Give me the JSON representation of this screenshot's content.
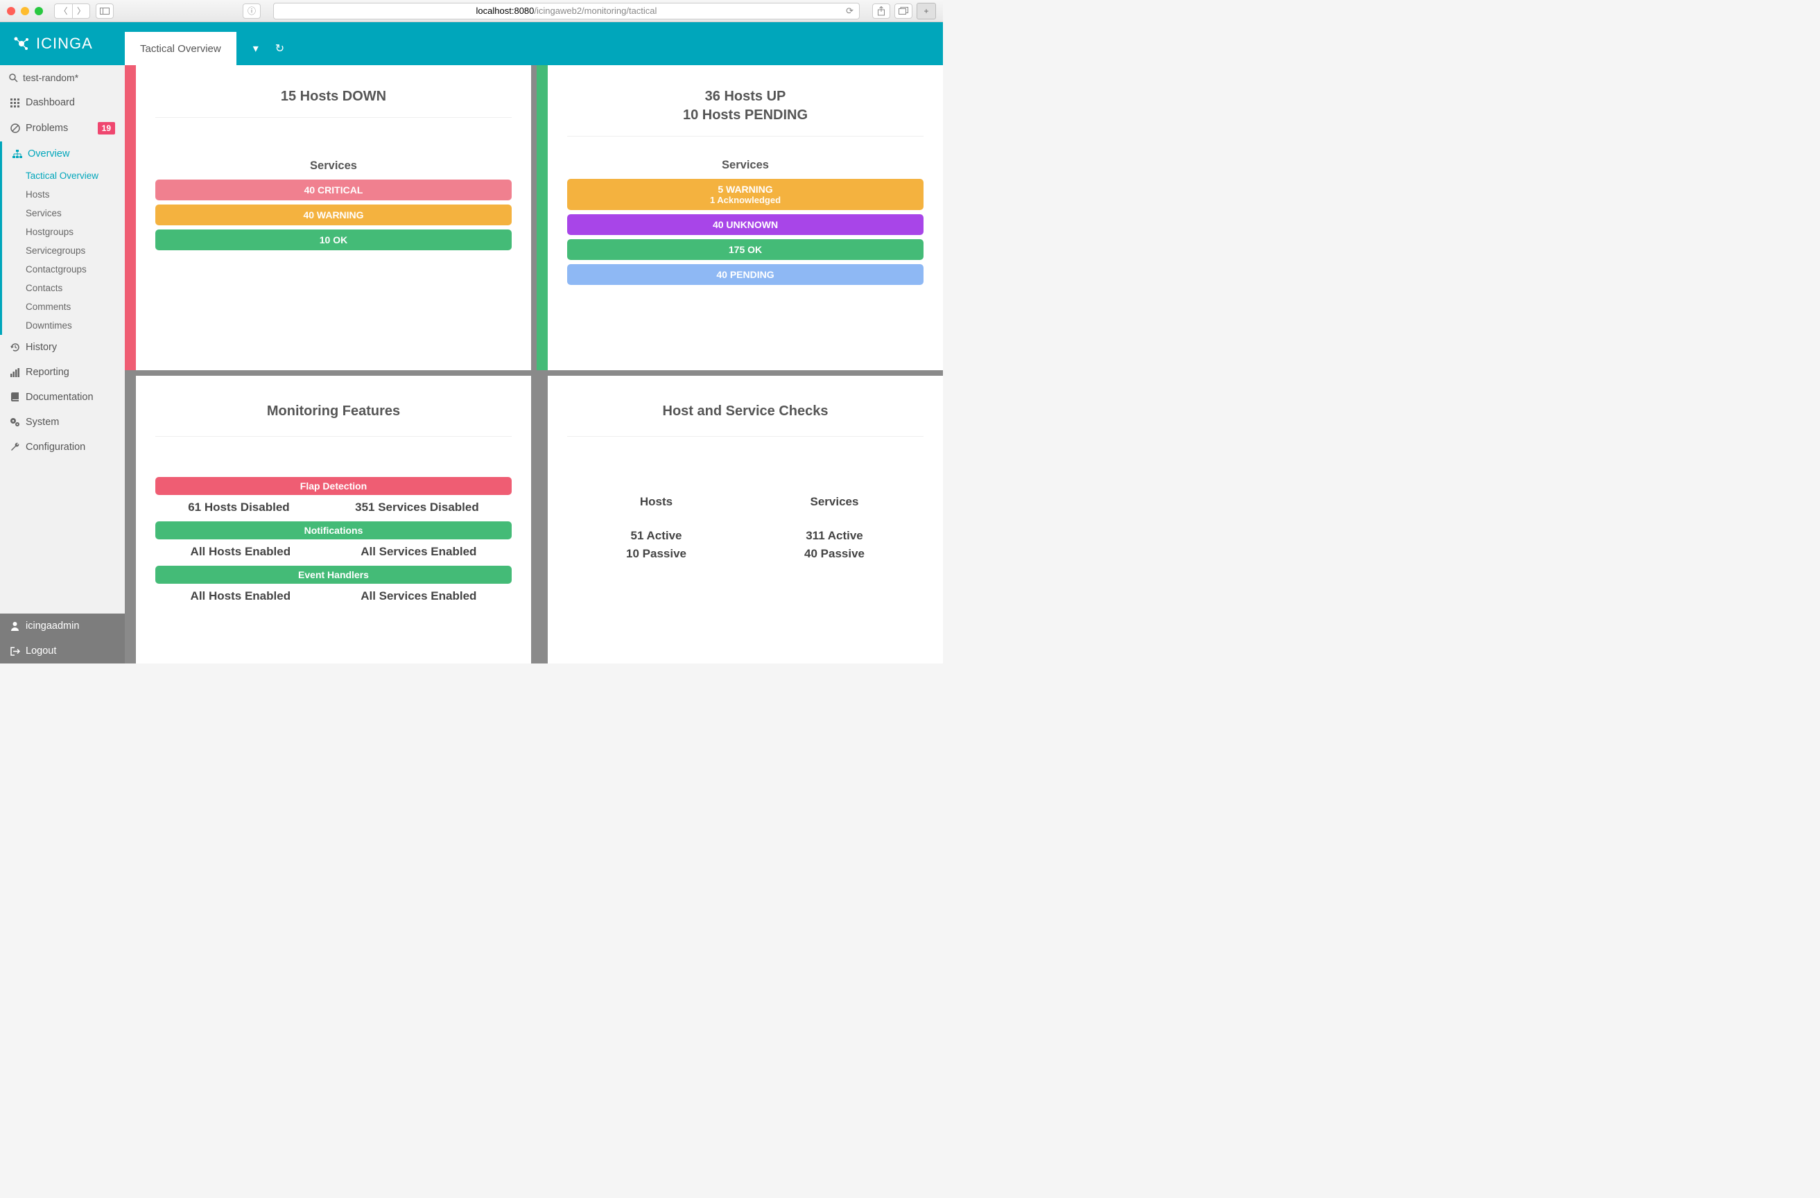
{
  "browser": {
    "url_host": "localhost:8080",
    "url_path": "/icingaweb2/monitoring/tactical"
  },
  "logo_text": "ICINGA",
  "tab": {
    "label": "Tactical Overview"
  },
  "search": {
    "query": "test-random*"
  },
  "nav": {
    "dashboard": "Dashboard",
    "problems": "Problems",
    "problems_badge": "19",
    "overview": "Overview",
    "overview_subs": {
      "tactical": "Tactical Overview",
      "hosts": "Hosts",
      "services": "Services",
      "hostgroups": "Hostgroups",
      "servicegroups": "Servicegroups",
      "contactgroups": "Contactgroups",
      "contacts": "Contacts",
      "comments": "Comments",
      "downtimes": "Downtimes"
    },
    "history": "History",
    "reporting": "Reporting",
    "documentation": "Documentation",
    "system": "System",
    "configuration": "Configuration",
    "user": "icingaadmin",
    "logout": "Logout"
  },
  "panel_down": {
    "title": "15 Hosts DOWN",
    "services_label": "Services",
    "bars": {
      "critical": "40 CRITICAL",
      "warning": "40 WARNING",
      "ok": "10 OK"
    }
  },
  "panel_up": {
    "title1": "36 Hosts UP",
    "title2": "10 Hosts PENDING",
    "services_label": "Services",
    "bars": {
      "warning": "5 WARNING",
      "warning_sub": "1 Acknowledged",
      "unknown": "40 UNKNOWN",
      "ok": "175 OK",
      "pending": "40 PENDING"
    }
  },
  "panel_features": {
    "title": "Monitoring Features",
    "flap_label": "Flap Detection",
    "flap_hosts": "61 Hosts Disabled",
    "flap_services": "351 Services Disabled",
    "notif_label": "Notifications",
    "notif_hosts": "All Hosts Enabled",
    "notif_services": "All Services Enabled",
    "eh_label": "Event Handlers",
    "eh_hosts": "All Hosts Enabled",
    "eh_services": "All Services Enabled"
  },
  "panel_checks": {
    "title": "Host and Service Checks",
    "hosts_label": "Hosts",
    "services_label": "Services",
    "hosts_active": "51 Active",
    "hosts_passive": "10 Passive",
    "services_active": "311 Active",
    "services_passive": "40 Passive"
  }
}
